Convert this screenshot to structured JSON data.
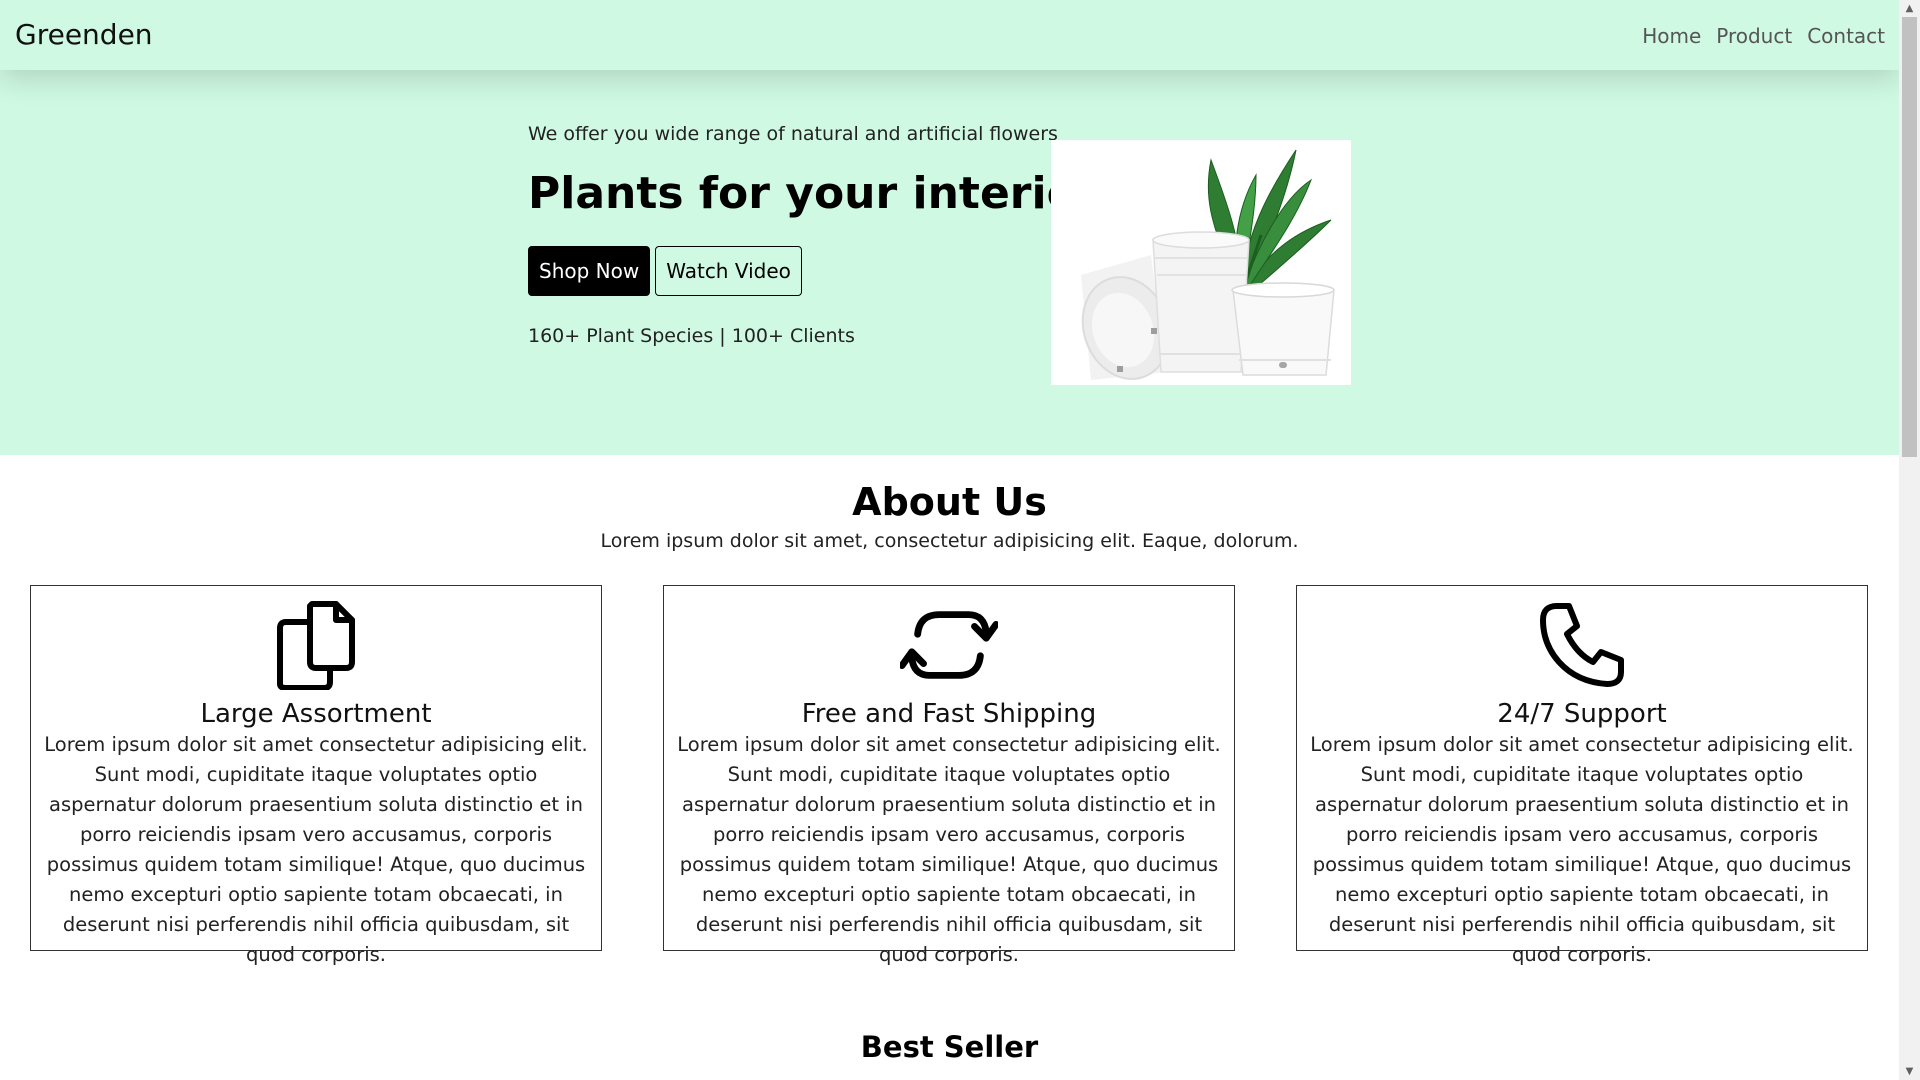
{
  "navbar": {
    "brand": "Greenden",
    "links": [
      "Home",
      "Product",
      "Contact"
    ]
  },
  "hero": {
    "subtitle": "We offer you wide range of natural and artificial flowers",
    "title": "Plants for your interiors",
    "shop_button": "Shop Now",
    "watch_button": "Watch Video",
    "stats": "160+ Plant Species | 100+ Clients",
    "image_icon": "potted-plant-image"
  },
  "about": {
    "title": "About Us",
    "subtitle": "Lorem ipsum dolor sit amet, consectetur adipisicing elit. Eaque, dolorum.",
    "cards": [
      {
        "icon": "files-icon",
        "title": "Large Assortment",
        "text": "Lorem ipsum dolor sit amet consectetur adipisicing elit. Sunt modi, cupiditate itaque voluptates optio aspernatur dolorum praesentium soluta distinctio et in porro reiciendis ipsam vero accusamus, corporis possimus quidem totam similique! Atque, quo ducimus nemo excepturi optio sapiente totam obcaecati, in deserunt nisi perferendis nihil officia quibusdam, sit quod corporis."
      },
      {
        "icon": "repeat-arrows-icon",
        "title": "Free and Fast Shipping",
        "text": "Lorem ipsum dolor sit amet consectetur adipisicing elit. Sunt modi, cupiditate itaque voluptates optio aspernatur dolorum praesentium soluta distinctio et in porro reiciendis ipsam vero accusamus, corporis possimus quidem totam similique! Atque, quo ducimus nemo excepturi optio sapiente totam obcaecati, in deserunt nisi perferendis nihil officia quibusdam, sit quod corporis."
      },
      {
        "icon": "phone-icon",
        "title": "24/7 Support",
        "text": "Lorem ipsum dolor sit amet consectetur adipisicing elit. Sunt modi, cupiditate itaque voluptates optio aspernatur dolorum praesentium soluta distinctio et in porro reiciendis ipsam vero accusamus, corporis possimus quidem totam similique! Atque, quo ducimus nemo excepturi optio sapiente totam obcaecati, in deserunt nisi perferendis nihil officia quibusdam, sit quod corporis."
      }
    ]
  },
  "best_seller": {
    "title": "Best Seller"
  },
  "colors": {
    "accent_mint": "#cff9e3",
    "button_dark": "#000000"
  }
}
